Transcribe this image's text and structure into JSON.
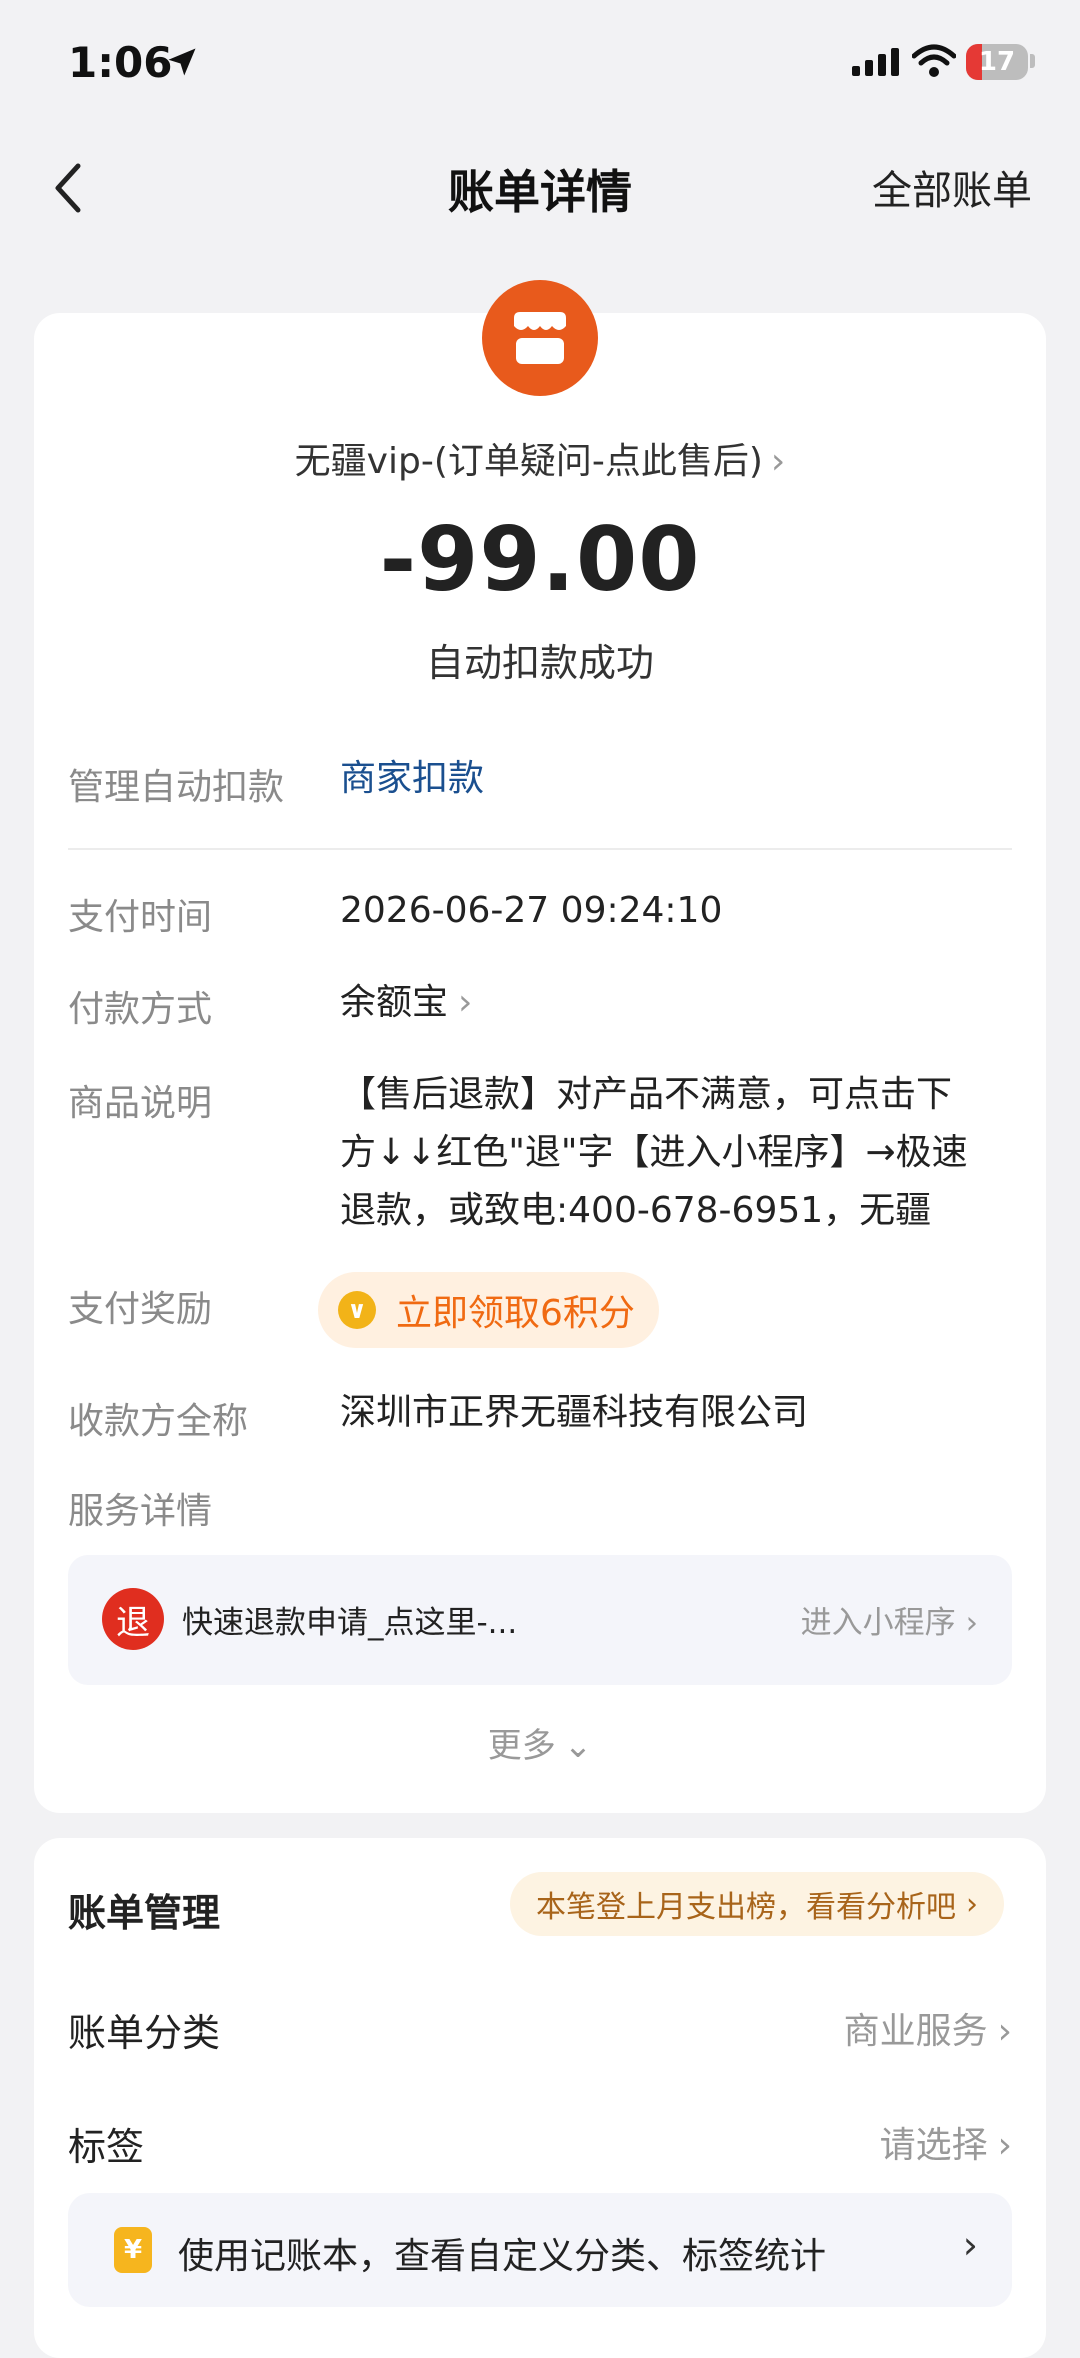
{
  "status": {
    "time": "1:06",
    "battery": "17"
  },
  "nav": {
    "title": "账单详情",
    "all_bills": "全部账单"
  },
  "merchant": {
    "name": "无疆vip-(订单疑问-点此售后)",
    "amount": "-99.00",
    "status": "自动扣款成功"
  },
  "details": {
    "auto_label": "管理自动扣款",
    "auto_value": "商家扣款",
    "time_label": "支付时间",
    "time_value": "2026-06-27 09:24:10",
    "method_label": "付款方式",
    "method_value": "余额宝",
    "desc_label": "商品说明",
    "desc_lines": [
      "【售后退款】对产品不满意，可点击下",
      "方↓↓红色\"退\"字【进入小程序】→极速",
      "退款，或致电:400-678-6951，无疆"
    ],
    "reward_label": "支付奖励",
    "reward_value": "立即领取6积分",
    "payee_label": "收款方全称",
    "payee_value": "深圳市正界无疆科技有限公司",
    "service_label": "服务详情"
  },
  "service": {
    "badge": "退",
    "text": "快速退款申请_点这里-...",
    "enter": "进入小程序"
  },
  "more": "更多",
  "management": {
    "title": "账单管理",
    "badge": "本笔登上月支出榜，看看分析吧",
    "category_label": "账单分类",
    "category_value": "商业服务",
    "tag_label": "标签",
    "tag_value": "请选择",
    "ledger_icon": "¥",
    "ledger_text": "使用记账本，查看自定义分类、标签统计"
  },
  "colors": {
    "accent_orange": "#e85a1c",
    "link_blue": "#1a4f8f",
    "refund_red": "#e02e1f"
  }
}
